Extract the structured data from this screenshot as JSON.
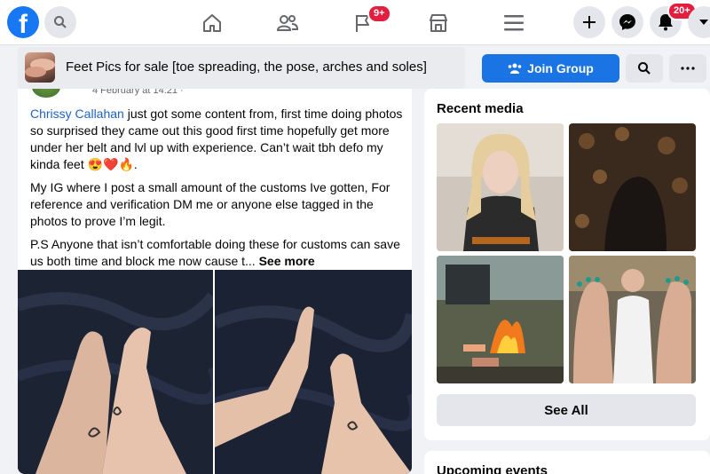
{
  "topbar": {
    "logo": "f",
    "icons": [
      "facebook-logo",
      "search-icon",
      "home-icon",
      "friends-icon",
      "flag-icon",
      "marketplace-icon",
      "menu-icon",
      "plus-icon",
      "messenger-icon",
      "bell-icon",
      "caret-down-icon"
    ],
    "pages_badge": "9+",
    "notifications_badge": "20+"
  },
  "group": {
    "title": "Feet Pics for sale [toe spreading, the pose, arches and soles]",
    "join_label": "Join Group",
    "brand_color": "#1b74e4"
  },
  "post": {
    "timestamp": "4 February at 14:21 ·",
    "author_mention": "Chrissy Callahan",
    "para1_rest": " just got some content from, first time doing photos so surprised they came out this good first time hopefully get more under her belt and lvl up with experience. Can’t wait tbh defo my kinda feet 😍❤️🔥.",
    "para2": "My IG where I post a small amount of the customs Ive gotten, For reference and verification DM me or anyone else tagged in the photos to prove I’m legit.",
    "para3": "P.S Anyone that isn’t comfortable doing these for customs can save us both time and block me now cause t... ",
    "see_more": "See more"
  },
  "sidebar": {
    "recent_media_title": "Recent media",
    "see_all_label": "See All",
    "upcoming_events_title": "Upcoming events"
  }
}
